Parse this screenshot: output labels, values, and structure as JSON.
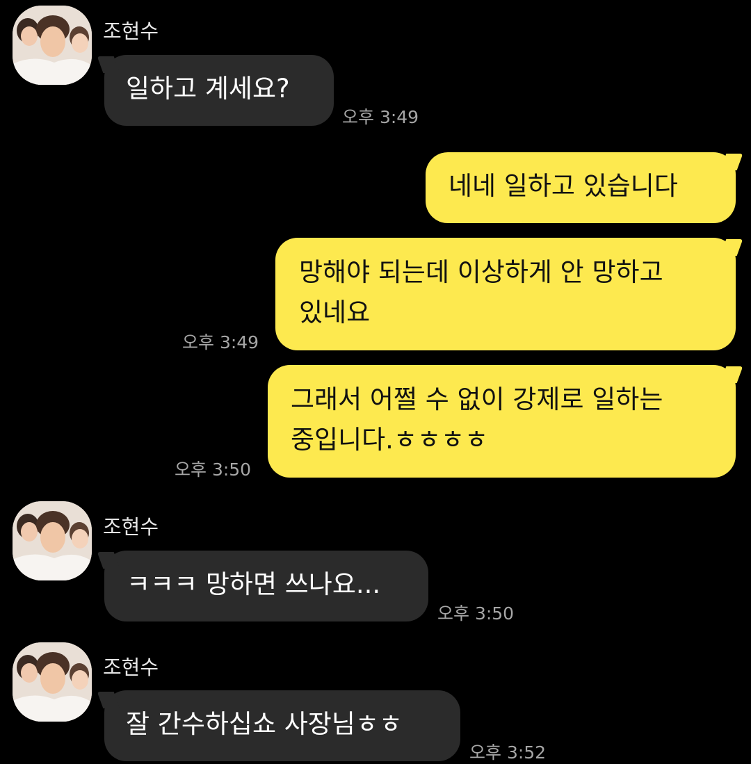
{
  "colors": {
    "background": "#000000",
    "incoming_bubble": "#2b2b2b",
    "outgoing_bubble": "#fde94f",
    "timestamp": "#a6a6a6"
  },
  "messages": [
    {
      "direction": "incoming",
      "sender": "조현수",
      "avatar_icon": "profile-photo-avatar",
      "lines": [
        "일하고 계세요?"
      ],
      "time": "오후 3:49"
    },
    {
      "direction": "outgoing",
      "lines": [
        "네네 일하고 있습니다"
      ]
    },
    {
      "direction": "outgoing",
      "lines": [
        "망해야 되는데 이상하게 안 망하고",
        "있네요"
      ],
      "time": "오후 3:49"
    },
    {
      "direction": "outgoing",
      "lines": [
        "그래서 어쩔 수 없이 강제로 일하는",
        "중입니다.ㅎㅎㅎㅎ"
      ],
      "time": "오후 3:50"
    },
    {
      "direction": "incoming",
      "sender": "조현수",
      "avatar_icon": "profile-photo-avatar",
      "lines": [
        "ㅋㅋㅋ 망하면 쓰나요..."
      ],
      "time": "오후 3:50"
    },
    {
      "direction": "incoming",
      "sender": "조현수",
      "avatar_icon": "profile-photo-avatar",
      "lines": [
        "잘 간수하십쇼 사장님ㅎㅎ"
      ],
      "time": "오후 3:52"
    }
  ]
}
